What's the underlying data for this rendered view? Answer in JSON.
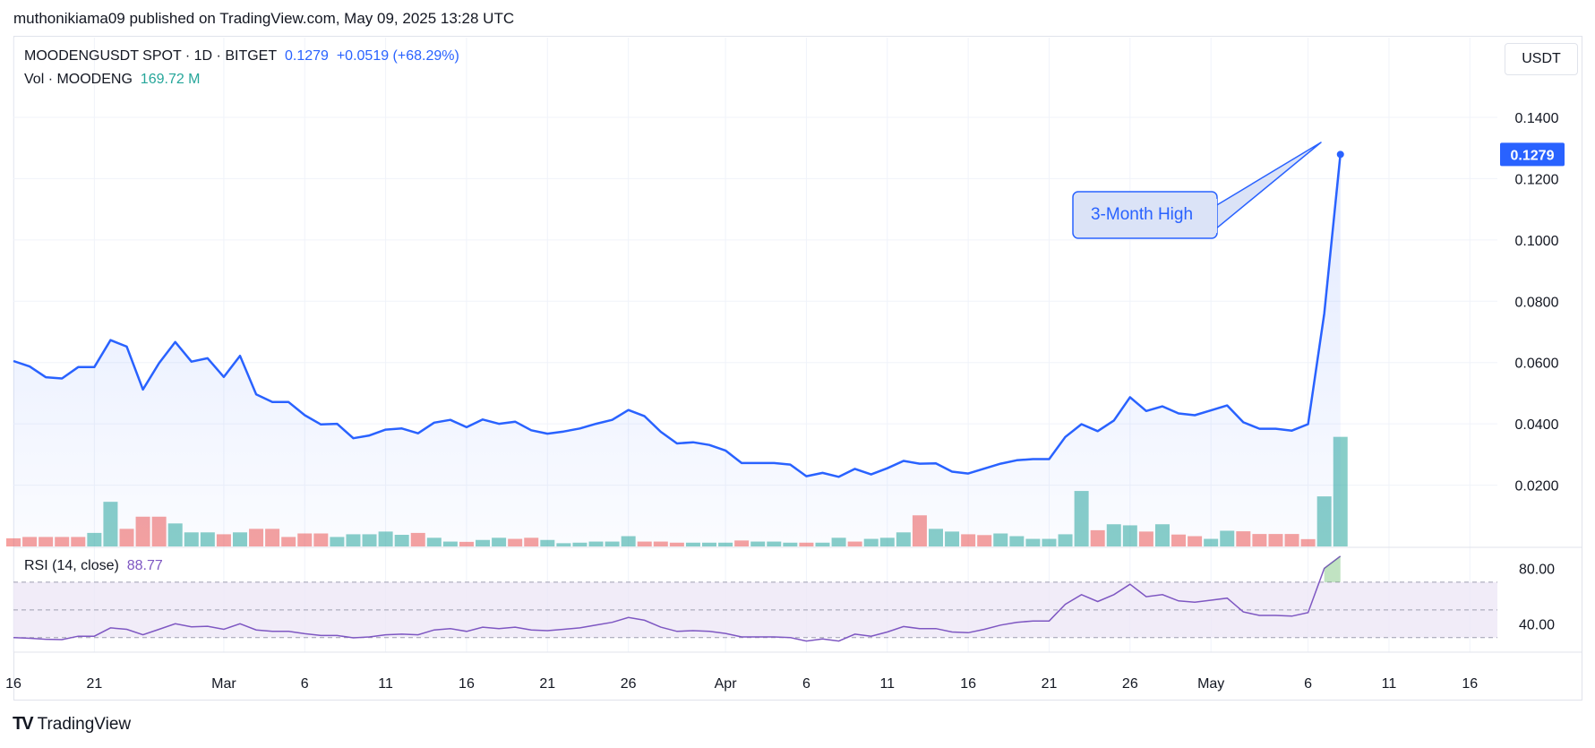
{
  "header": {
    "publisher_line": "muthonikiama09 published on TradingView.com, May 09, 2025 13:28 UTC"
  },
  "legend": {
    "symbol": "MOODENGUSDT SPOT · 1D · BITGET",
    "price": "0.1279",
    "change": "+0.0519 (+68.29%)",
    "vol_label": "Vol · MOODENG",
    "vol_value": "169.72 M",
    "rsi_label": "RSI (14, close)",
    "rsi_value": "88.77"
  },
  "currency_button": "USDT",
  "annotation": "3-Month High",
  "footer": {
    "logo": "TV",
    "brand": "TradingView"
  },
  "colors": {
    "line": "#2962ff",
    "vol_up": "#26a69a",
    "vol_down": "#ef5350",
    "rsi": "#7e57c2",
    "rsi_band": "#ede7f6",
    "grid": "#f0f3fa"
  },
  "chart_data": {
    "type": "line",
    "title": "MOODENGUSDT SPOT · 1D · BITGET",
    "x_start_date": "2025-02-16",
    "x_tick_labels": [
      "16",
      "21",
      "Mar",
      "6",
      "11",
      "16",
      "21",
      "26",
      "Apr",
      "6",
      "11",
      "16",
      "21",
      "26",
      "May",
      "6",
      "11",
      "16"
    ],
    "y_axis": {
      "ticks": [
        "0.1400",
        "0.1200",
        "0.1000",
        "0.0800",
        "0.0600",
        "0.0400",
        "0.0200"
      ],
      "ylim": [
        0.0,
        0.147
      ]
    },
    "last_price_label": "0.1279",
    "series": [
      {
        "name": "MOODENGUSDT",
        "values": [
          0.0605,
          0.0587,
          0.0552,
          0.0548,
          0.0585,
          0.0585,
          0.0673,
          0.0652,
          0.0512,
          0.0598,
          0.0667,
          0.0603,
          0.0614,
          0.0553,
          0.0622,
          0.0496,
          0.0471,
          0.0471,
          0.0428,
          0.0398,
          0.04,
          0.0353,
          0.0362,
          0.0381,
          0.0385,
          0.0369,
          0.0404,
          0.0413,
          0.0389,
          0.0414,
          0.04,
          0.0407,
          0.0379,
          0.0368,
          0.0375,
          0.0385,
          0.04,
          0.0413,
          0.0445,
          0.0425,
          0.0374,
          0.0336,
          0.034,
          0.0331,
          0.0313,
          0.0272,
          0.0272,
          0.0272,
          0.0267,
          0.0229,
          0.024,
          0.0227,
          0.0253,
          0.0235,
          0.0255,
          0.0279,
          0.027,
          0.0271,
          0.0244,
          0.0238,
          0.0254,
          0.027,
          0.0281,
          0.0285,
          0.0285,
          0.0357,
          0.0399,
          0.0376,
          0.0411,
          0.0487,
          0.0442,
          0.0457,
          0.0434,
          0.0428,
          0.0444,
          0.046,
          0.0405,
          0.0384,
          0.0384,
          0.0378,
          0.0399,
          0.076,
          0.1279
        ]
      }
    ],
    "volume": {
      "name": "Vol · MOODENG",
      "ylim": [
        0,
        48
      ],
      "values": [
        3,
        3.5,
        3.5,
        3.5,
        3.5,
        5,
        16.5,
        6.5,
        11,
        11,
        8.5,
        5.2,
        5.2,
        4.5,
        5.2,
        6.5,
        6.5,
        3.5,
        4.8,
        4.8,
        3.5,
        4.5,
        4.5,
        5.5,
        4.3,
        5,
        3.2,
        1.8,
        1.7,
        2.4,
        3.2,
        2.8,
        3.2,
        2.4,
        1.2,
        1.4,
        1.8,
        1.8,
        3.8,
        1.8,
        1.8,
        1.4,
        1.4,
        1.4,
        1.4,
        2.2,
        1.8,
        1.8,
        1.4,
        1.4,
        1.4,
        3.2,
        1.8,
        2.8,
        3.2,
        5.2,
        11.5,
        6.5,
        5.5,
        4.5,
        4.2,
        4.8,
        3.8,
        2.8,
        2.8,
        4.5,
        20.5,
        6,
        8.2,
        7.8,
        5.5,
        8.2,
        4.4,
        3.8,
        2.8,
        5.8,
        5.6,
        4.6,
        4.6,
        4.6,
        2.7,
        18.5,
        40.5
      ],
      "up": [
        false,
        false,
        false,
        false,
        false,
        true,
        true,
        false,
        false,
        false,
        true,
        true,
        true,
        false,
        true,
        false,
        false,
        false,
        false,
        false,
        true,
        true,
        true,
        true,
        true,
        false,
        true,
        true,
        false,
        true,
        true,
        false,
        false,
        true,
        true,
        true,
        true,
        true,
        true,
        false,
        false,
        false,
        true,
        true,
        true,
        false,
        true,
        true,
        true,
        false,
        true,
        true,
        false,
        true,
        true,
        true,
        false,
        true,
        true,
        false,
        false,
        true,
        true,
        true,
        true,
        true,
        true,
        false,
        true,
        true,
        false,
        true,
        false,
        false,
        true,
        true,
        false,
        false,
        false,
        false,
        false,
        true,
        true
      ]
    },
    "rsi": {
      "name": "RSI (14, close)",
      "ticks": [
        "80.00",
        "40.00"
      ],
      "overbought": 70,
      "oversold": 30,
      "ylim": [
        24,
        90
      ],
      "values": [
        30,
        29.5,
        28.8,
        28.5,
        31,
        31,
        37,
        36,
        32,
        36,
        40,
        37.8,
        38.2,
        36,
        40,
        35.5,
        34.5,
        34.5,
        32.8,
        31.5,
        31.5,
        29.8,
        30.5,
        32,
        32.5,
        32,
        35.5,
        36.5,
        34.5,
        37.5,
        36.5,
        37.5,
        35.5,
        35,
        36,
        37,
        39,
        41,
        44.5,
        42.5,
        37.5,
        34.5,
        35,
        34.5,
        33,
        30.5,
        30.5,
        30.5,
        30,
        27.5,
        29,
        27.5,
        32.5,
        31,
        34,
        38,
        36.5,
        36.5,
        34,
        33.5,
        36,
        39,
        41,
        42,
        42,
        54,
        61,
        56,
        61,
        68.5,
        59.5,
        61,
        56.5,
        55.5,
        57,
        58.5,
        48.5,
        46,
        46,
        45.5,
        48,
        80,
        88.77
      ]
    }
  }
}
